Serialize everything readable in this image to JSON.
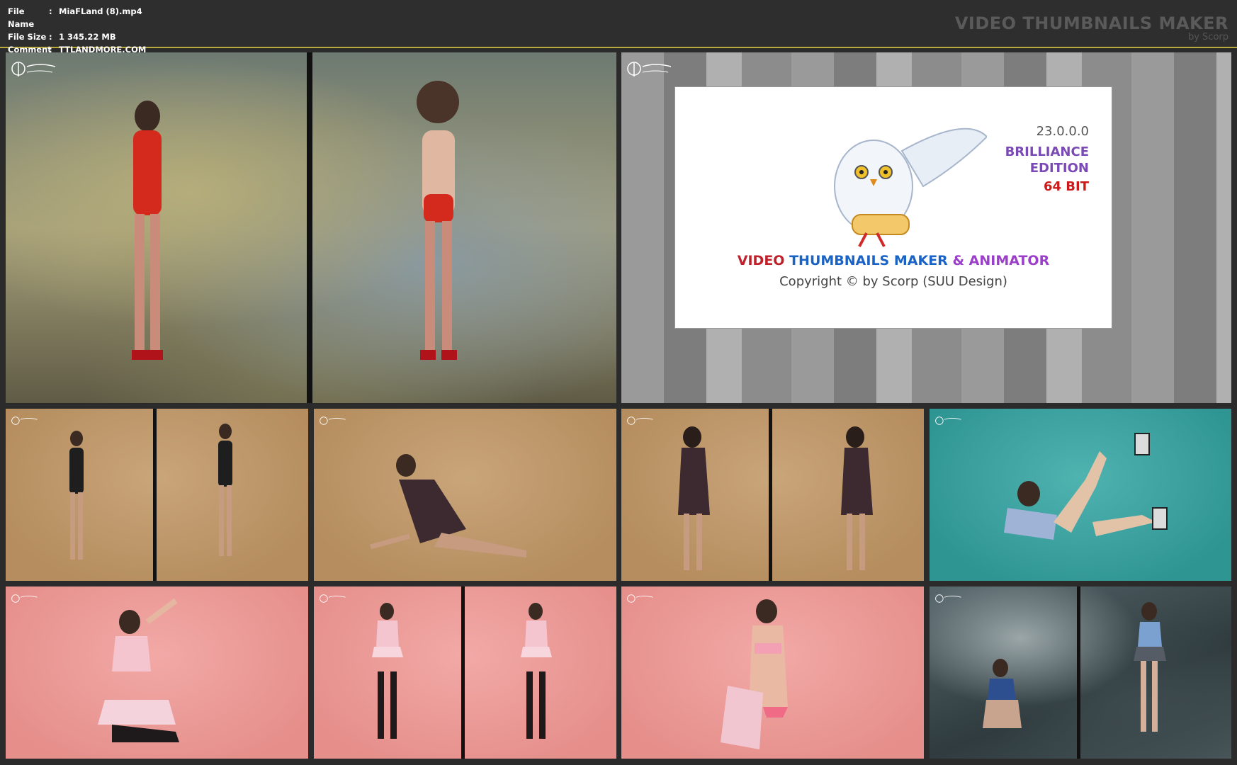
{
  "meta": {
    "file_name_label": "File Name",
    "file_name": "MiaFLand (8).mp4",
    "file_size_label": "File Size",
    "file_size": "1 345.22 MB",
    "comment_label": "Comment",
    "comment": "TTLANDMORE.COM",
    "separator": ":"
  },
  "brand": {
    "title": "VIDEO THUMBNAILS MAKER",
    "subtitle": "by Scorp"
  },
  "splash": {
    "version": "23.0.0.0",
    "edition_line1": "BRILLIANCE",
    "edition_line2": "EDITION",
    "bits": "64 BIT",
    "product_video": "VIDEO",
    "product_thumbnails": "THUMBNAILS MAKER",
    "product_amp": "&",
    "product_animator": "ANIMATOR",
    "copyright": "Copyright © by Scorp (SUU Design)"
  },
  "colors": {
    "accent_border": "#b9a93a",
    "brand_text": "#5a5a5a"
  }
}
